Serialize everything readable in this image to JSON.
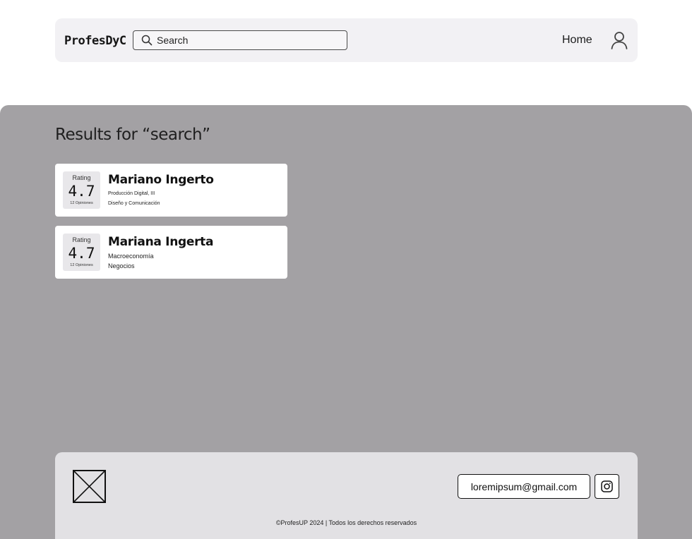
{
  "header": {
    "brand": "ProfesDyC",
    "search_placeholder": "Search",
    "search_icon": "search-icon",
    "nav_home": "Home",
    "user_icon": "user-icon"
  },
  "results": {
    "title": "Results for “search”",
    "items": [
      {
        "rating_label": "Rating",
        "rating_value": "4.7",
        "opinions": "12 Opiniones",
        "name": "Mariano Ingerto",
        "subject_1": "Producción Digital, III",
        "subject_2": "Diseño y Comunicación"
      },
      {
        "rating_label": "Rating",
        "rating_value": "4.7",
        "opinions": "12 Opiniones",
        "name": "Mariana Ingerta",
        "subject_1": "Macroeconomía",
        "subject_2": "Negocios"
      }
    ]
  },
  "footer": {
    "logo_icon": "image-placeholder-icon",
    "email": "loremipsum@gmail.com",
    "social_icon": "instagram-icon",
    "copyright": "©ProfesUP 2024 | Todos los derechos reservados"
  },
  "colors": {
    "navbar_bg": "#f2f1f4",
    "panel_bg": "#a3a1a4",
    "footer_bg": "#e2e1e4",
    "card_bg": "#ffffff"
  }
}
